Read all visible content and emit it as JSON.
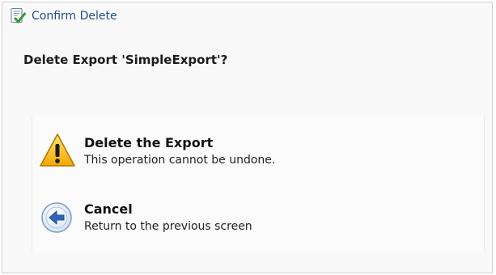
{
  "dialog": {
    "title": "Confirm Delete",
    "title_icon": "document-check-icon",
    "question": "Delete Export 'SimpleExport'?"
  },
  "options": [
    {
      "title": "Delete the Export",
      "description": "This operation cannot be undone.",
      "icon": "warning-icon",
      "icon_color": "#f4b400"
    },
    {
      "title": "Cancel",
      "description": "Return to the previous screen",
      "icon": "back-arrow-icon",
      "icon_color": "#3a6fb5"
    }
  ]
}
